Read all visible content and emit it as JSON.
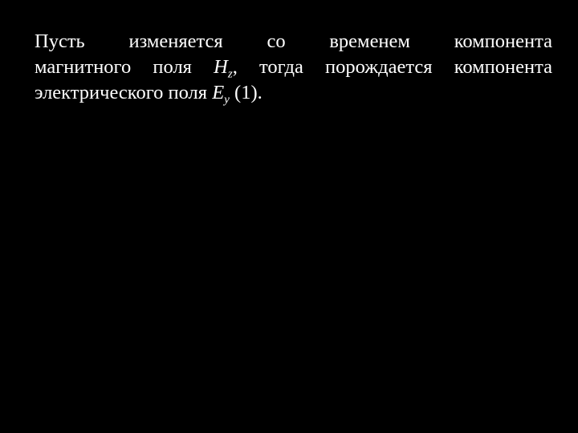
{
  "slide": {
    "background_color": "#000000",
    "text_color": "#ffffff",
    "paragraph": {
      "lines": [
        {
          "text": "Пусть изменяется со временем компонента"
        },
        {
          "before": "магнитного поля ",
          "symbol": "H",
          "subscript": "z",
          "after": ", тогда порождается компонента"
        },
        {
          "before": "электрического поля ",
          "symbol": "E",
          "subscript": "y",
          "after": " (1)."
        }
      ]
    }
  }
}
